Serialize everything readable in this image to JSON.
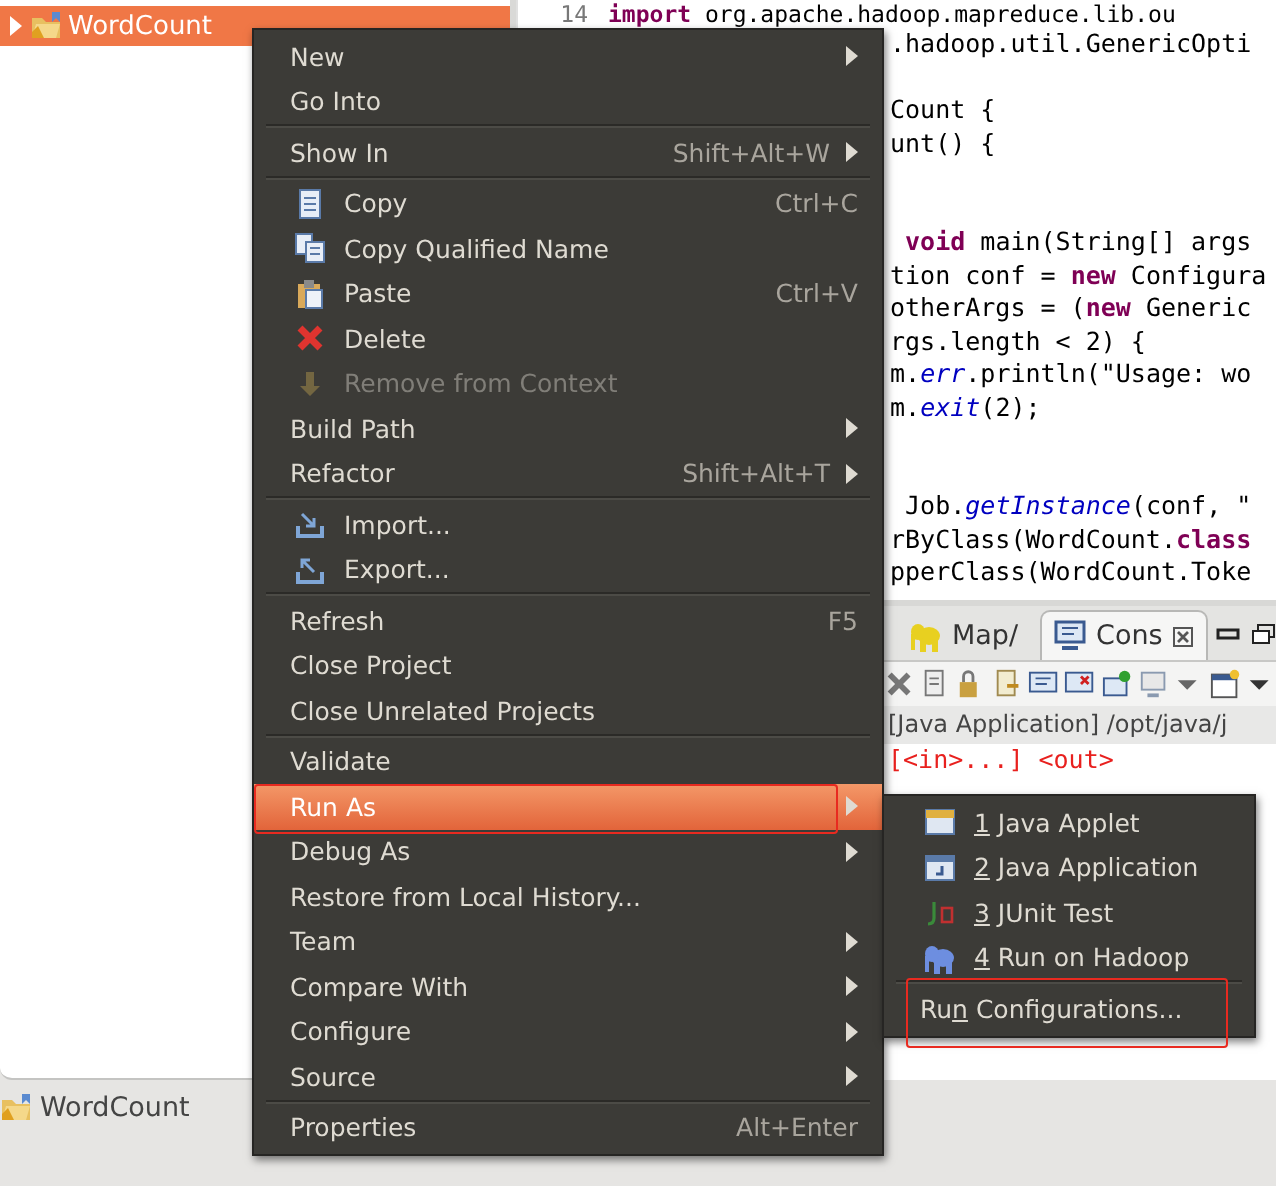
{
  "project_explorer": {
    "items": [
      {
        "label": "WordCount",
        "selected": true,
        "expanded": false
      }
    ]
  },
  "editor": {
    "lines": [
      {
        "kind": "full",
        "number": "14",
        "text": "**import** org.apache.hadoop.mapreduce.lib.ou"
      },
      {
        "kind": "fragment",
        "text": ".hadoop.util.GenericOpti"
      },
      {
        "kind": "blank"
      },
      {
        "kind": "fragment",
        "text": "Count {"
      },
      {
        "kind": "fragment",
        "text": "unt() {"
      },
      {
        "kind": "blank"
      },
      {
        "kind": "blank"
      },
      {
        "kind": "fragment",
        "text": " **void** main(String[] args"
      },
      {
        "kind": "fragment",
        "text": "tion conf = **new** Configura"
      },
      {
        "kind": "fragment",
        "text": "otherArgs = (**new** Generic"
      },
      {
        "kind": "fragment",
        "text": "rgs.length < 2) {"
      },
      {
        "kind": "fragment",
        "text": "m.*err*.println(\"Usage: wo"
      },
      {
        "kind": "fragment",
        "text": "m.*exit*(2);"
      },
      {
        "kind": "blank"
      },
      {
        "kind": "blank"
      },
      {
        "kind": "fragment",
        "text": " Job.*getInstance*(conf, \""
      },
      {
        "kind": "fragment",
        "text": "rByClass(WordCount.**class**"
      },
      {
        "kind": "fragment",
        "text": "pperClass(WordCount.Toke"
      }
    ]
  },
  "console": {
    "tabs": [
      {
        "label": "Map/",
        "selected": false
      },
      {
        "label": "Cons",
        "selected": true
      }
    ],
    "launch_info": "[Java Application] /opt/java/j",
    "output": "[<in>...] <out>"
  },
  "context_menu": {
    "items": [
      {
        "kind": "item",
        "label": "New",
        "submenu": true,
        "disabled": false,
        "selected": false,
        "marked": false
      },
      {
        "kind": "item",
        "label": "Go Into",
        "submenu": false,
        "disabled": false,
        "selected": false,
        "marked": false
      },
      {
        "kind": "separator"
      },
      {
        "kind": "item",
        "label": "Show In",
        "shortcut": "Shift+Alt+W",
        "submenu": true,
        "disabled": false,
        "selected": false,
        "marked": false
      },
      {
        "kind": "separator"
      },
      {
        "kind": "icon_item",
        "label": "Copy",
        "shortcut": "Ctrl+C",
        "submenu": false,
        "disabled": false,
        "selected": false,
        "marked": false
      },
      {
        "kind": "icon_item",
        "label": "Copy Qualified Name",
        "submenu": false,
        "disabled": false,
        "selected": false,
        "marked": false
      },
      {
        "kind": "icon_item",
        "label": "Paste",
        "shortcut": "Ctrl+V",
        "submenu": false,
        "disabled": false,
        "selected": false,
        "marked": false
      },
      {
        "kind": "icon_item",
        "label": "Delete",
        "submenu": false,
        "disabled": false,
        "selected": false,
        "marked": false
      },
      {
        "kind": "icon_item",
        "label": "Remove from Context",
        "submenu": false,
        "disabled": true,
        "selected": false,
        "marked": false
      },
      {
        "kind": "item",
        "label": "Build Path",
        "submenu": true,
        "disabled": false,
        "selected": false,
        "marked": false
      },
      {
        "kind": "item",
        "label": "Refactor",
        "shortcut": "Shift+Alt+T",
        "submenu": true,
        "disabled": false,
        "selected": false,
        "marked": false
      },
      {
        "kind": "separator"
      },
      {
        "kind": "icon_item",
        "label": "Import...",
        "submenu": false,
        "disabled": false,
        "selected": false,
        "marked": false
      },
      {
        "kind": "icon_item",
        "label": "Export...",
        "submenu": false,
        "disabled": false,
        "selected": false,
        "marked": false
      },
      {
        "kind": "separator"
      },
      {
        "kind": "item",
        "label": "Refresh",
        "shortcut": "F5",
        "submenu": false,
        "disabled": false,
        "selected": false,
        "marked": false
      },
      {
        "kind": "item",
        "label": "Close Project",
        "submenu": false,
        "disabled": false,
        "selected": false,
        "marked": false
      },
      {
        "kind": "item",
        "label": "Close Unrelated Projects",
        "submenu": false,
        "disabled": false,
        "selected": false,
        "marked": false
      },
      {
        "kind": "separator"
      },
      {
        "kind": "item",
        "label": "Validate",
        "submenu": false,
        "disabled": false,
        "selected": false,
        "marked": false
      },
      {
        "kind": "item",
        "label": "Run As",
        "submenu": true,
        "disabled": false,
        "selected": true,
        "marked": true
      },
      {
        "kind": "item",
        "label": "Debug As",
        "submenu": true,
        "disabled": false,
        "selected": false,
        "marked": false
      },
      {
        "kind": "item",
        "label": "Restore from Local History...",
        "submenu": false,
        "disabled": false,
        "selected": false,
        "marked": false
      },
      {
        "kind": "item",
        "label": "Team",
        "submenu": true,
        "disabled": false,
        "selected": false,
        "marked": false
      },
      {
        "kind": "item",
        "label": "Compare With",
        "submenu": true,
        "disabled": false,
        "selected": false,
        "marked": false
      },
      {
        "kind": "item",
        "label": "Configure",
        "submenu": true,
        "disabled": false,
        "selected": false,
        "marked": false
      },
      {
        "kind": "item",
        "label": "Source",
        "submenu": true,
        "disabled": false,
        "selected": false,
        "marked": false
      },
      {
        "kind": "separator"
      },
      {
        "kind": "item",
        "label": "Properties",
        "shortcut": "Alt+Enter",
        "submenu": false,
        "disabled": false,
        "selected": false,
        "marked": false
      }
    ]
  },
  "submenu": {
    "items": [
      {
        "kind": "icon_item",
        "mnemonic": "1",
        "after": " Java Applet",
        "selected": false,
        "marked": false
      },
      {
        "kind": "icon_item",
        "mnemonic": "2",
        "after": " Java Application",
        "selected": false,
        "marked": false
      },
      {
        "kind": "icon_item",
        "mnemonic": "3",
        "after": " JUnit Test",
        "selected": false,
        "marked": false
      },
      {
        "kind": "icon_item",
        "mnemonic": "4",
        "after": " Run on Hadoop",
        "selected": false,
        "marked": false
      },
      {
        "kind": "separator"
      },
      {
        "kind": "item",
        "before": "Ru",
        "mnemonic": "n",
        "after": " Configurations...",
        "selected": false,
        "marked": true
      }
    ]
  },
  "status_bar": {
    "label": "WordCount"
  }
}
